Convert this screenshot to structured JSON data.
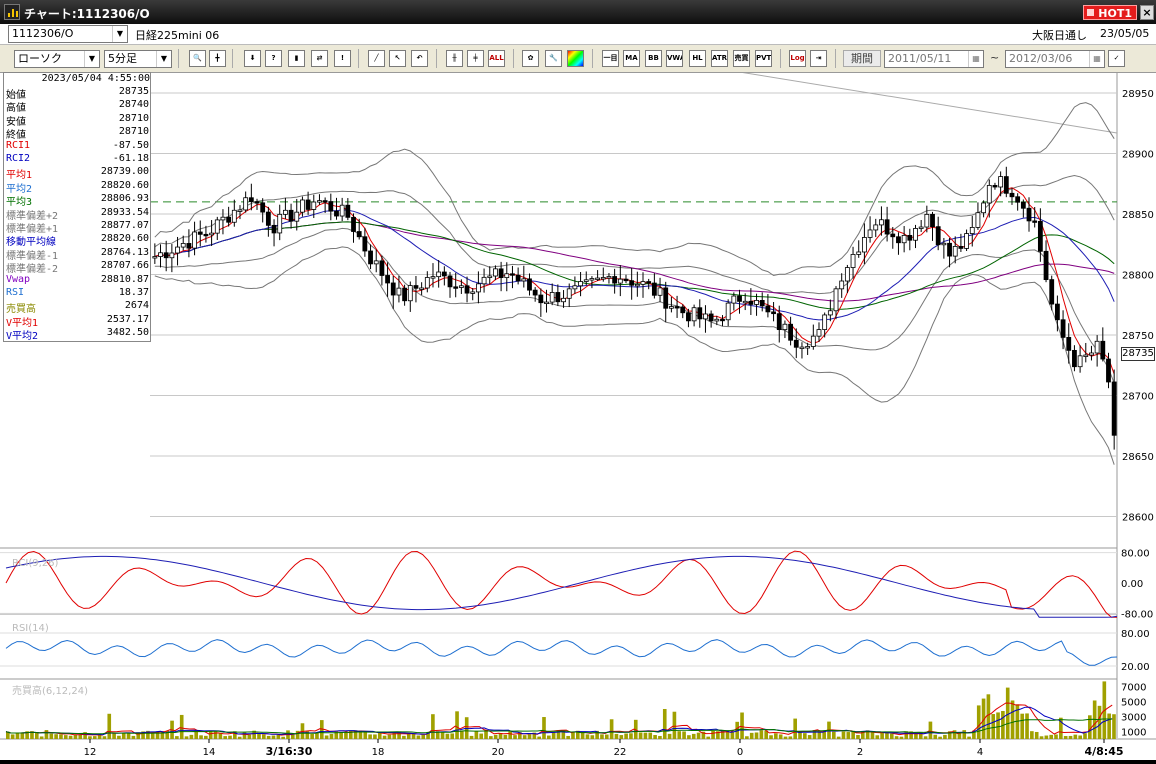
{
  "window": {
    "title": "チャート:1112306/O",
    "hot_label": "HOT1",
    "close_label": "×"
  },
  "symbol_bar": {
    "code": "1112306/O",
    "product": "日経225mini 06",
    "session": "大阪日通し",
    "date": "23/05/05"
  },
  "toolbar": {
    "chart_type": "ローソク",
    "interval": "5分足",
    "icons": [
      "zoom-icon",
      "crosshair-icon",
      "download-icon",
      "query-icon",
      "bar-icon",
      "compare-icon",
      "info-icon",
      "trend-line-icon",
      "pointer-icon",
      "undo-icon",
      "candle-icon",
      "candle-alt-icon",
      "all-icon",
      "settings-icon",
      "wrench-icon",
      "color-icon"
    ],
    "indicator_buttons": [
      "一目",
      "MA",
      "BB",
      "VWAP",
      "HL",
      "ATR",
      "売買",
      "PVT"
    ],
    "log_label": "Log",
    "period_label": "期間",
    "period_from": "2011/05/11",
    "period_sep": "~",
    "period_to": "2012/03/06"
  },
  "info": {
    "datetime": "2023/05/04  4:55:00",
    "rows": [
      {
        "label": "始値",
        "value": "28735",
        "color": "#000000"
      },
      {
        "label": "高値",
        "value": "28740",
        "color": "#000000"
      },
      {
        "label": "安値",
        "value": "28710",
        "color": "#000000"
      },
      {
        "label": "終値",
        "value": "28710",
        "color": "#000000"
      },
      {
        "label": "RCI1",
        "value": "-87.50",
        "color": "#e00000"
      },
      {
        "label": "RCI2",
        "value": "-61.18",
        "color": "#0000c0"
      },
      {
        "label": "平均1",
        "value": "28739.00",
        "color": "#e00000"
      },
      {
        "label": "平均2",
        "value": "28820.60",
        "color": "#1e6fd0"
      },
      {
        "label": "平均3",
        "value": "28806.93",
        "color": "#007000"
      },
      {
        "label": "標準偏差+2",
        "value": "28933.54",
        "color": "#777777"
      },
      {
        "label": "標準偏差+1",
        "value": "28877.07",
        "color": "#777777"
      },
      {
        "label": "移動平均線",
        "value": "28820.60",
        "color": "#0000c0"
      },
      {
        "label": "標準偏差-1",
        "value": "28764.13",
        "color": "#777777"
      },
      {
        "label": "標準偏差-2",
        "value": "28707.66",
        "color": "#777777"
      },
      {
        "label": "Vwap",
        "value": "28810.87",
        "color": "#8000c0"
      },
      {
        "label": "RSI",
        "value": "18.37",
        "color": "#1e6fd0"
      },
      {
        "label": "売買高",
        "value": "2674",
        "color": "#8a8a00"
      },
      {
        "label": "V平均1",
        "value": "2537.17",
        "color": "#e00000"
      },
      {
        "label": "V平均2",
        "value": "3482.50",
        "color": "#0000c0"
      }
    ]
  },
  "current_price": "28735",
  "price_axis": [
    "28950",
    "28900",
    "28850",
    "28800",
    "28750",
    "28700",
    "28650",
    "28600"
  ],
  "reference_line_price": 28860,
  "rci_panel": {
    "label": "RCI(9,26)",
    "ticks": [
      "80.00",
      "0.00",
      "-80.00"
    ]
  },
  "rsi_panel": {
    "label": "RSI(14)",
    "ticks": [
      "80.00",
      "20.00"
    ]
  },
  "vol_panel": {
    "label": "売買高(6,12,24)",
    "ticks": [
      "7000",
      "5000",
      "3000",
      "1000"
    ]
  },
  "time_axis": [
    "12",
    "14",
    "3/16:30",
    "18",
    "20",
    "22",
    "0",
    "2",
    "4",
    "4/8:45"
  ],
  "colors": {
    "bull_candle": "#ffffff",
    "bear_candle": "#000000",
    "ma_short": "#e00000",
    "ma_mid": "#1e1eb4",
    "ma_long": "#006400",
    "vwap": "#800080",
    "bollinger": "#777777",
    "rci_short": "#e00000",
    "rci_long": "#1e1eb4",
    "rsi": "#1e6fd0",
    "volume": "#a0a000",
    "ref_line": "#2a8a2a"
  }
}
